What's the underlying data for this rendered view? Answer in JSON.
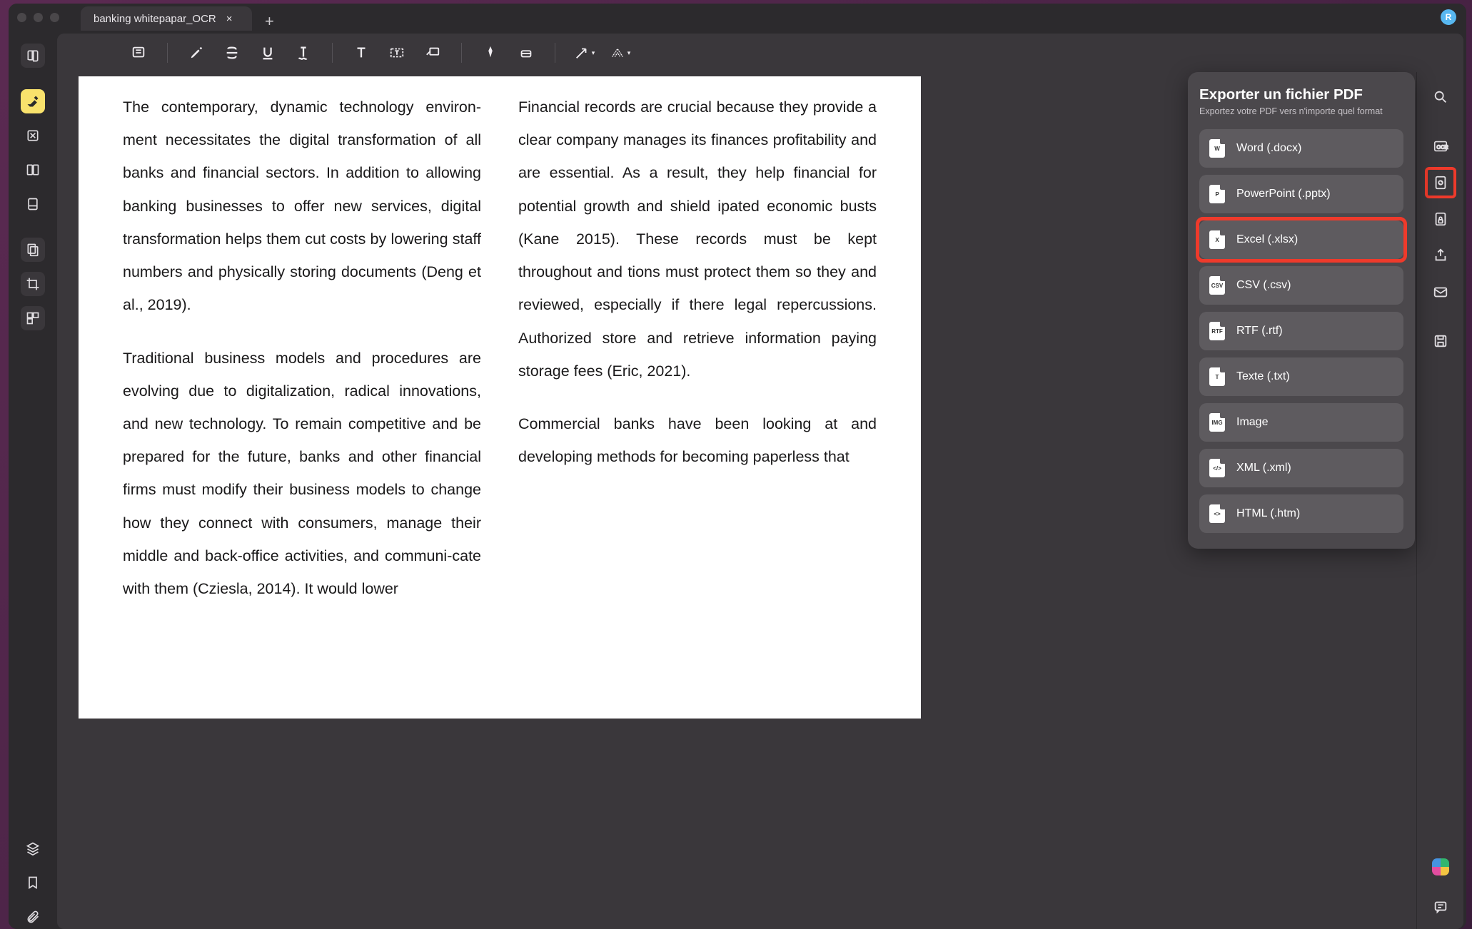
{
  "tab": {
    "title": "banking whitepapar_OCR"
  },
  "avatar_initial": "R",
  "document": {
    "p1": "The contemporary, dynamic technology environ-ment necessitates the digital transformation of all banks and financial sectors. In addition to allowing banking businesses to offer new services, digital transformation helps them cut costs by lowering staff numbers and physically storing documents (Deng et al., 2019).",
    "p2": "Traditional business models and procedures are evolving due to digitalization, radical innovations, and new technology. To remain competitive and be prepared for the future, banks and other financial firms must modify their business models to change how they connect with consumers, manage their middle and back-office activities, and communi-cate with them (Cziesla, 2014). It would lower",
    "p3": "Financial records are crucial because they provide a clear company manages its finances profitability and are essential. As a result, they help financial for potential growth and shield ipated economic busts (Kane 2015). These records must be kept throughout and tions must protect them so they and reviewed, especially if there legal repercussions. Authorized store and retrieve information paying storage fees (Eric, 2021).",
    "p4": "Commercial banks have been looking at and developing methods for becoming paperless that"
  },
  "export": {
    "title": "Exporter un fichier PDF",
    "subtitle": "Exportez votre PDF vers n'importe quel format",
    "options": [
      {
        "label": "Word (.docx)",
        "badge": "W"
      },
      {
        "label": "PowerPoint (.pptx)",
        "badge": "P"
      },
      {
        "label": "Excel (.xlsx)",
        "badge": "X",
        "highlight": true
      },
      {
        "label": "CSV (.csv)",
        "badge": "CSV"
      },
      {
        "label": "RTF (.rtf)",
        "badge": "RTF"
      },
      {
        "label": "Texte (.txt)",
        "badge": "T"
      },
      {
        "label": "Image",
        "badge": "IMG"
      },
      {
        "label": "XML (.xml)",
        "badge": "</>"
      },
      {
        "label": "HTML (.htm)",
        "badge": "<>"
      }
    ]
  },
  "left_sidebar": [
    "read-mode",
    "highlight-mode",
    "edit-mode",
    "view-double",
    "page-tools",
    "thumbnails",
    "crop",
    "organize"
  ],
  "right_sidebar": [
    "search",
    "ocr",
    "export",
    "protect",
    "share",
    "mail",
    "save"
  ]
}
